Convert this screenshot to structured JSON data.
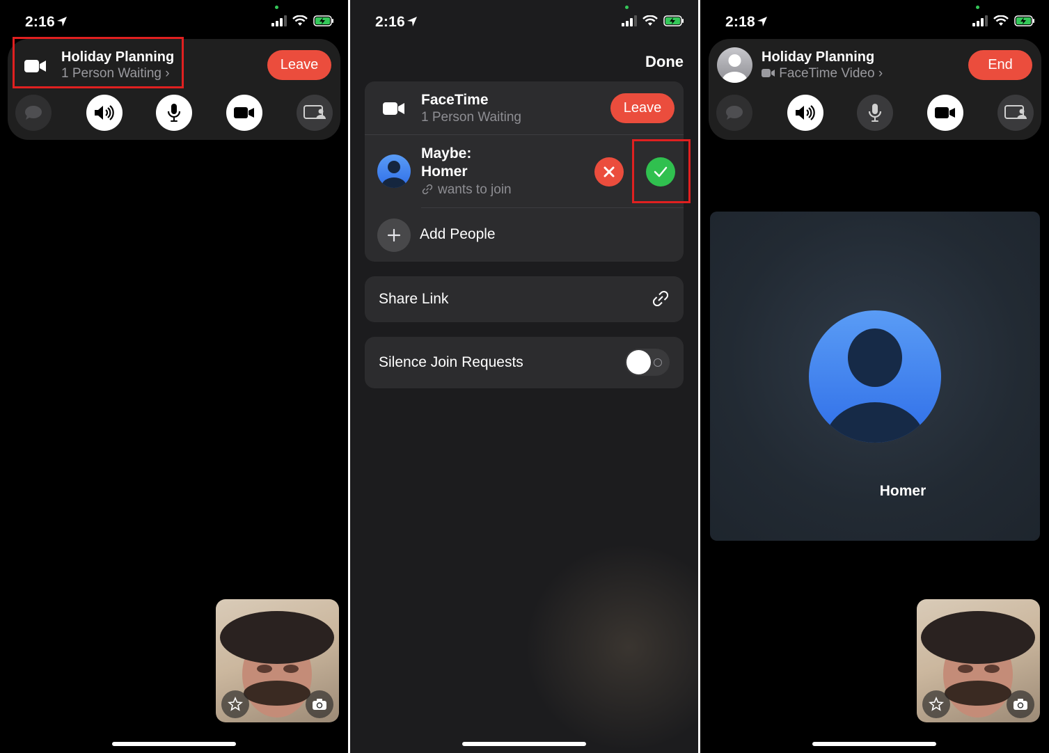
{
  "screen1": {
    "status": {
      "time": "2:16"
    },
    "call": {
      "title": "Holiday Planning",
      "subtitle": "1 Person Waiting",
      "leave_label": "Leave"
    },
    "controls": [
      "message-icon",
      "speaker-icon",
      "mic-icon",
      "camera-icon",
      "shareplay-icon"
    ]
  },
  "screen2": {
    "status": {
      "time": "2:16"
    },
    "done_label": "Done",
    "facetime": {
      "title": "FaceTime",
      "subtitle": "1 Person Waiting",
      "leave_label": "Leave"
    },
    "request": {
      "line1": "Maybe:",
      "line2": "Homer",
      "note": "wants to join"
    },
    "add_people_label": "Add People",
    "share_link_label": "Share Link",
    "silence_label": "Silence Join Requests",
    "silence_on": false
  },
  "screen3": {
    "status": {
      "time": "2:18"
    },
    "call": {
      "title": "Holiday Planning",
      "subtitle": "FaceTime Video",
      "end_label": "End"
    },
    "participant_name": "Homer"
  },
  "colors": {
    "accent_red": "#eb4d3d",
    "accept_green": "#30c04f",
    "highlight": "#e02020",
    "avatar_blue": "#2f6ee8"
  }
}
